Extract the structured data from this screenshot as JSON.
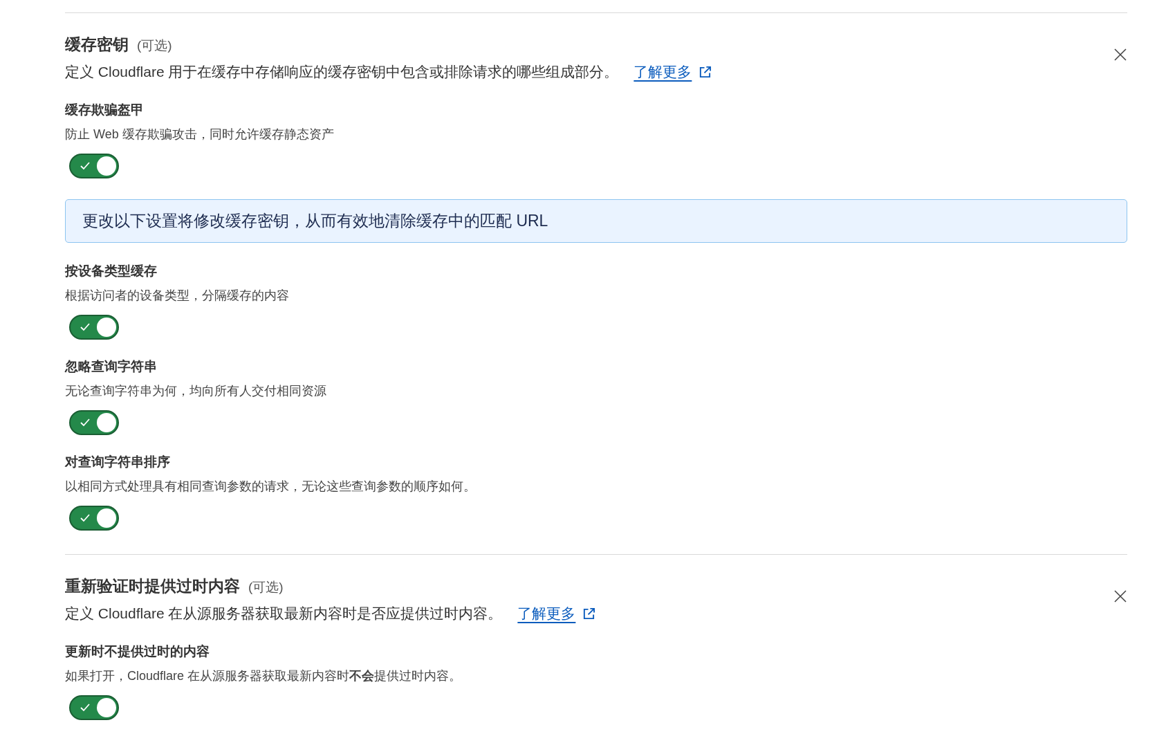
{
  "sections": [
    {
      "title": "缓存密钥",
      "tag": "(可选)",
      "description": "定义 Cloudflare 用于在缓存中存储响应的缓存密钥中包含或排除请求的哪些组成部分。",
      "link": "了解更多",
      "items": [
        {
          "kind": "toggle",
          "title": "缓存欺骗盔甲",
          "description": "防止 Web 缓存欺骗攻击，同时允许缓存静态资产",
          "on": true
        },
        {
          "kind": "notice",
          "text": "更改以下设置将修改缓存密钥，从而有效地清除缓存中的匹配 URL"
        },
        {
          "kind": "toggle",
          "title": "按设备类型缓存",
          "description": "根据访问者的设备类型，分隔缓存的内容",
          "on": true
        },
        {
          "kind": "toggle",
          "title": "忽略查询字符串",
          "description": "无论查询字符串为何，均向所有人交付相同资源",
          "on": true
        },
        {
          "kind": "toggle",
          "title": "对查询字符串排序",
          "description": "以相同方式处理具有相同查询参数的请求，无论这些查询参数的顺序如何。",
          "on": true
        }
      ]
    },
    {
      "title": "重新验证时提供过时内容",
      "tag": "(可选)",
      "description": "定义 Cloudflare 在从源服务器获取最新内容时是否应提供过时内容。",
      "link": "了解更多",
      "items": [
        {
          "kind": "toggle",
          "title": "更新时不提供过时的内容",
          "description": "如果打开，Cloudflare 在从源服务器获取最新内容时**不会**提供过时内容。",
          "on": true
        }
      ]
    }
  ]
}
